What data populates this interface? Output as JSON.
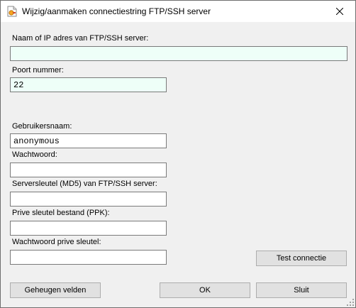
{
  "window": {
    "title": "Wijzig/aanmaken connectiestring FTP/SSH server"
  },
  "fields": {
    "host": {
      "label": "Naam of IP adres van FTP/SSH server:",
      "value": ""
    },
    "port": {
      "label": "Poort nummer:",
      "value": "22"
    },
    "username": {
      "label": "Gebruikersnaam:",
      "value": "anonymous"
    },
    "password": {
      "label": "Wachtwoord:",
      "value": ""
    },
    "server_key": {
      "label": "Serversleutel (MD5) van FTP/SSH server:",
      "value": ""
    },
    "private_key_file": {
      "label": "Prive sleutel bestand (PPK):",
      "value": ""
    },
    "private_key_password": {
      "label": "Wachtwoord prive sleutel:",
      "value": ""
    }
  },
  "buttons": {
    "test": "Test connectie",
    "remember": "Geheugen velden",
    "ok": "OK",
    "close": "Sluit"
  }
}
